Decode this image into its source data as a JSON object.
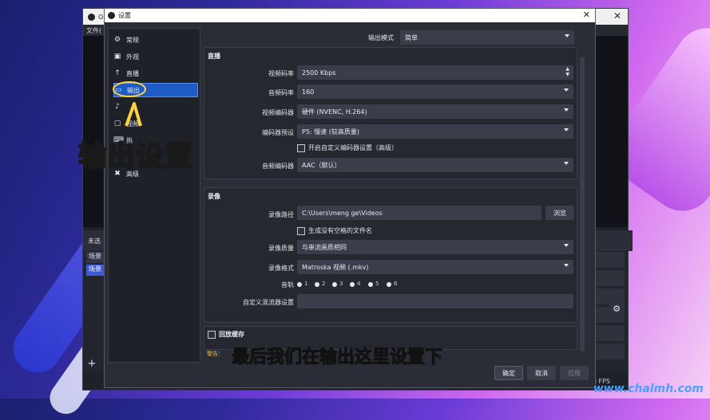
{
  "back_window": {
    "title_initial": "O",
    "menu_file": "文件(",
    "status_text": "未选",
    "scene_header": "场景",
    "scene_item": "场景",
    "fps": "0 FPS",
    "add_label": "+"
  },
  "settings": {
    "title": "设置",
    "close": "✕",
    "nav": [
      {
        "label": "常规",
        "icon": "gear-icon"
      },
      {
        "label": "外观",
        "icon": "palette-icon"
      },
      {
        "label": "直播",
        "icon": "broadcast-icon"
      },
      {
        "label": "输出",
        "icon": "output-icon"
      },
      {
        "label": "",
        "icon": "audio-icon"
      },
      {
        "label": "视频",
        "icon": "video-icon"
      },
      {
        "label": "热",
        "icon": "hotkey-icon"
      },
      {
        "label": "高级",
        "icon": "tools-icon"
      }
    ],
    "output_mode": {
      "label": "输出模式",
      "value": "简单"
    },
    "stream": {
      "title": "直播",
      "video_bitrate": {
        "label": "视频码率",
        "value": "2500 Kbps"
      },
      "audio_bitrate": {
        "label": "音频码率",
        "value": "160"
      },
      "video_encoder": {
        "label": "视频编码器",
        "value": "硬件 (NVENC, H.264)"
      },
      "encoder_preset": {
        "label": "编码器预设",
        "value": "P5: 慢速 (较高质量)"
      },
      "custom_encoder": "开启自定义编码器设置（高级）",
      "audio_encoder": {
        "label": "音频编码器",
        "value": "AAC（默认）"
      }
    },
    "recording": {
      "title": "录像",
      "path": {
        "label": "录像路径",
        "value": "C:\\Users\\meng ge\\Videos"
      },
      "browse": "浏览",
      "no_space": "生成没有空格的文件名",
      "quality": {
        "label": "录像质量",
        "value": "与串流画质相同"
      },
      "format": {
        "label": "录像格式",
        "value": "Matroska 视频 (.mkv)"
      },
      "tracks_label": "音轨",
      "tracks": [
        "1",
        "2",
        "3",
        "4",
        "5",
        "6"
      ],
      "muxer": {
        "label": "自定义混流器设置",
        "value": ""
      }
    },
    "replay": {
      "title": "回放缓存"
    },
    "warning": "警告：",
    "ok": "确定",
    "cancel": "取消",
    "apply": "应用"
  },
  "overlay": {
    "title": "输出设置",
    "caption": "最后我们在输出这里设置下",
    "watermark": "www.chalmh.com"
  },
  "colors": {
    "accent": "#1e5bc6",
    "dialog_bg": "#2a2d35",
    "watermark": "#4aa2ff"
  }
}
